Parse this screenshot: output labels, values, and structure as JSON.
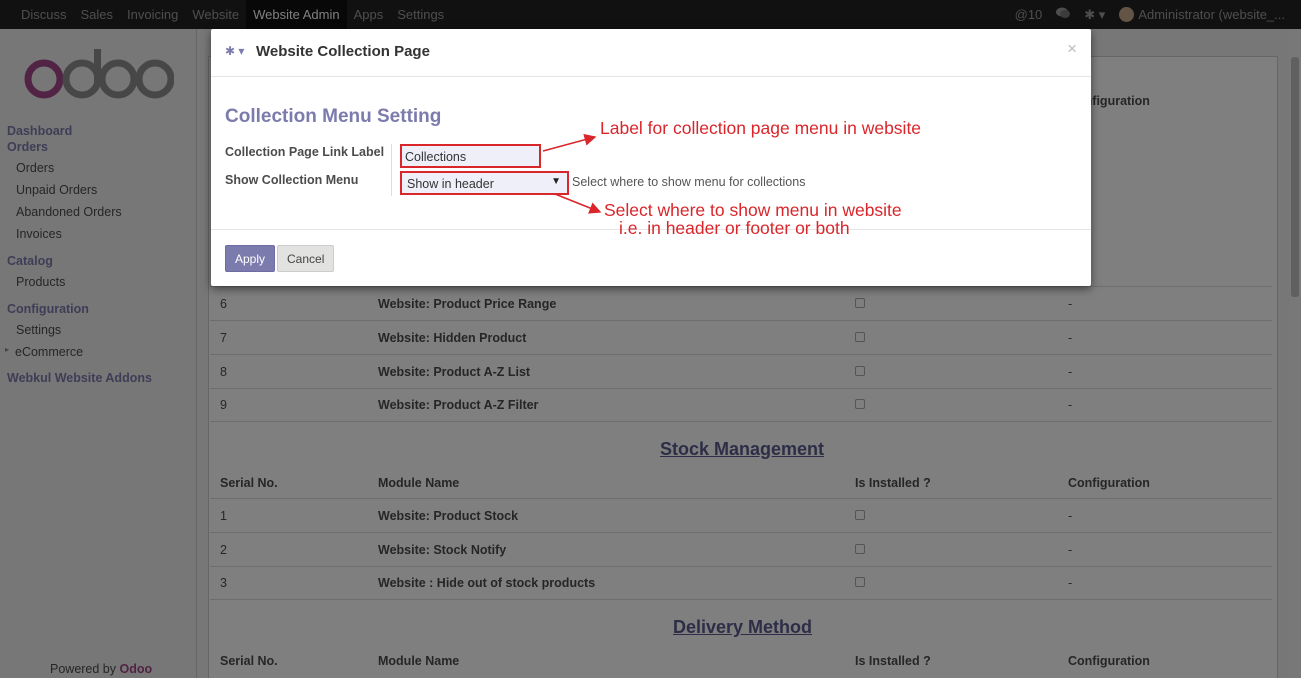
{
  "topbar": {
    "menu": [
      "Discuss",
      "Sales",
      "Invoicing",
      "Website",
      "Website Admin",
      "Apps",
      "Settings"
    ],
    "active": "Website Admin",
    "notif_count": "@10",
    "user": "Administrator (website_..."
  },
  "sidebar": {
    "dashboard": "Dashboard",
    "orders_section": "Orders",
    "orders_items": [
      "Orders",
      "Unpaid Orders",
      "Abandoned Orders",
      "Invoices"
    ],
    "catalog_section": "Catalog",
    "catalog_items": [
      "Products"
    ],
    "config_section": "Configuration",
    "config_items": [
      "Settings",
      "eCommerce"
    ],
    "addons_section": "Webkul Website Addons",
    "powered_prefix": "Powered by",
    "powered_brand": "Odoo"
  },
  "main": {
    "partial_header": "Configuration",
    "upper_rows": [
      {
        "no": "6",
        "name": "Website: Product Price Range",
        "config": "-"
      },
      {
        "no": "7",
        "name": "Website: Hidden Product",
        "config": "-"
      },
      {
        "no": "8",
        "name": "Website: Product A-Z List",
        "config": "-"
      },
      {
        "no": "9",
        "name": "Website: Product A-Z Filter",
        "config": "-"
      }
    ],
    "stock_title": "Stock Management",
    "headers": {
      "serial": "Serial No.",
      "module": "Module Name",
      "installed": "Is Installed ?",
      "config": "Configuration"
    },
    "stock_rows": [
      {
        "no": "1",
        "name": "Website: Product Stock",
        "config": "-"
      },
      {
        "no": "2",
        "name": "Website: Stock Notify",
        "config": "-"
      },
      {
        "no": "3",
        "name": "Website : Hide out of stock products",
        "config": "-"
      }
    ],
    "delivery_title": "Delivery Method"
  },
  "modal": {
    "title": "Website Collection Page",
    "form_title": "Collection Menu Setting",
    "label_field": "Collection Page Link Label",
    "label_value": "Collections",
    "menu_field": "Show Collection Menu",
    "menu_value": "Show in header",
    "menu_help": "Select where to show menu for collections",
    "apply": "Apply",
    "cancel": "Cancel"
  },
  "annotations": {
    "note1": "Label for collection page menu in website",
    "note2_line1": "Select where to show menu in website",
    "note2_line2": "i.e. in header or footer or both"
  }
}
